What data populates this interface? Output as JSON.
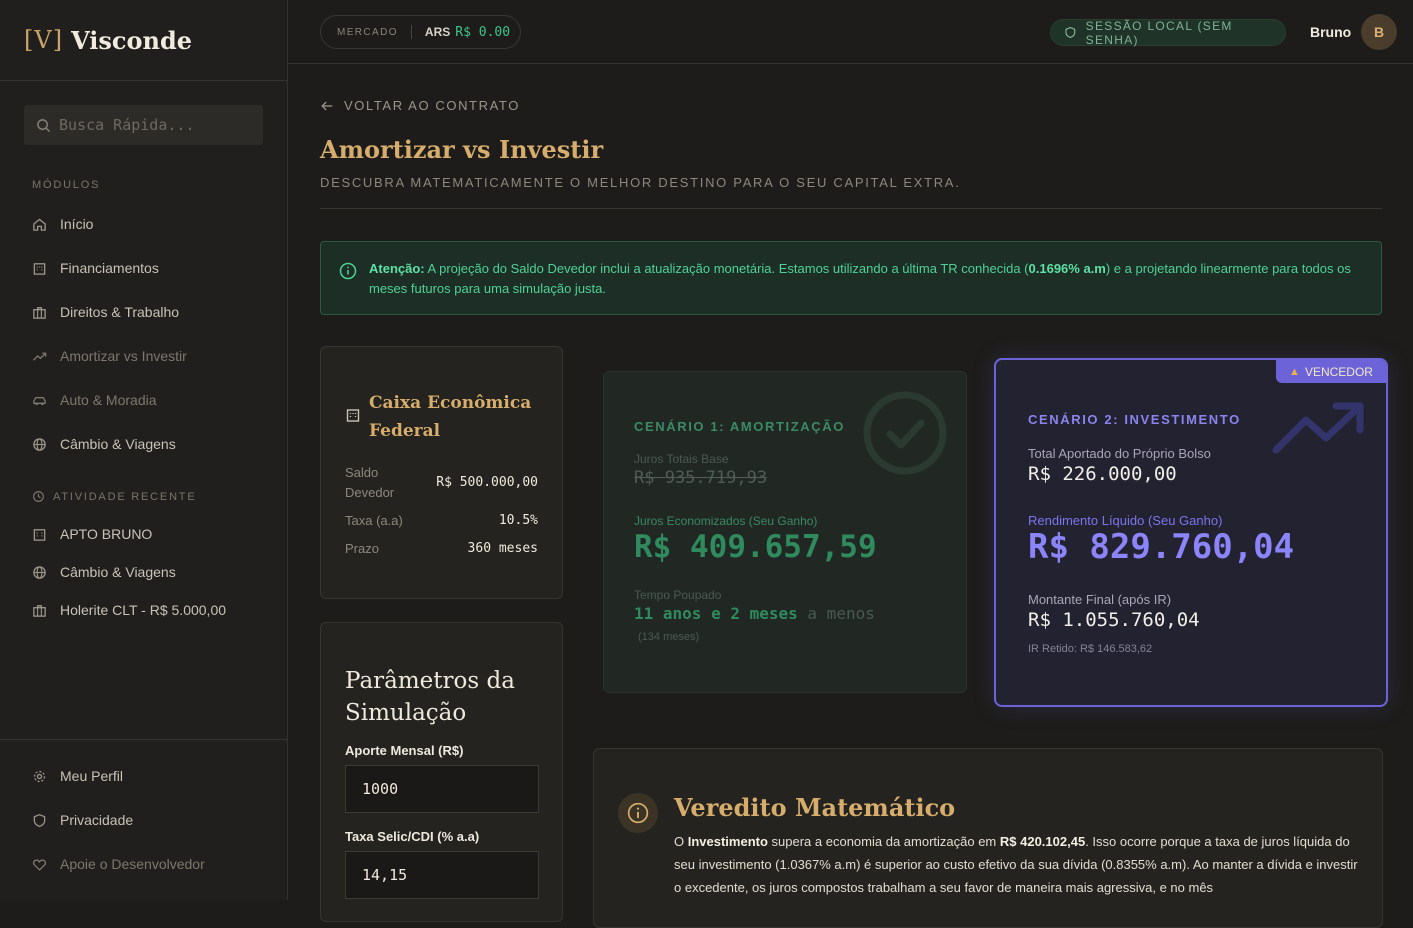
{
  "brand": {
    "bracket": "[V]",
    "name": "Visconde"
  },
  "search": {
    "placeholder": "Busca Rápida..."
  },
  "sidebar": {
    "modules_label": "MÓDULOS",
    "modules": [
      {
        "label": "Início",
        "icon": "home-icon"
      },
      {
        "label": "Financiamentos",
        "icon": "building-icon"
      },
      {
        "label": "Direitos & Trabalho",
        "icon": "briefcase-icon"
      },
      {
        "label": "Amortizar vs Investir",
        "icon": "trend-icon"
      },
      {
        "label": "Auto & Moradia",
        "icon": "car-icon"
      },
      {
        "label": "Câmbio & Viagens",
        "icon": "globe-icon"
      }
    ],
    "recent_label": "ATIVIDADE RECENTE",
    "recent": [
      {
        "label": "APTO BRUNO",
        "icon": "building-icon"
      },
      {
        "label": "Câmbio & Viagens",
        "icon": "globe-icon"
      },
      {
        "label": "Holerite CLT - R$ 5.000,00",
        "icon": "briefcase-icon"
      }
    ],
    "bottom": [
      {
        "label": "Meu Perfil",
        "icon": "gear-icon"
      },
      {
        "label": "Privacidade",
        "icon": "shield-icon"
      },
      {
        "label": "Apoie o Desenvolvedor",
        "icon": "heart-icon"
      }
    ]
  },
  "topbar": {
    "market_label": "MERCADO",
    "currency": "ARS",
    "rate": "R$ 0.00",
    "session": "SESSÃO LOCAL (SEM SENHA)",
    "user": "Bruno",
    "avatar_initial": "B"
  },
  "page": {
    "back": "VOLTAR AO CONTRATO",
    "title": "Amortizar vs Investir",
    "subtitle": "DESCUBRA MATEMATICAMENTE O MELHOR DESTINO PARA O SEU CAPITAL EXTRA."
  },
  "alert": {
    "bold": "Atenção:",
    "text1": " A projeção do Saldo Devedor inclui a atualização monetária. Estamos utilizando a última TR conhecida (",
    "rate": "0.1696% a.m",
    "text2": ") e a projetando linearmente para todos os meses futuros para uma simulação justa."
  },
  "contract": {
    "bank": "Caixa Econômica Federal",
    "saldo_label": "Saldo Devedor",
    "saldo_value": "R$ 500.000,00",
    "taxa_label": "Taxa (a.a)",
    "taxa_value": "10.5%",
    "prazo_label": "Prazo",
    "prazo_value": "360 meses"
  },
  "params": {
    "title": "Parâmetros da Simulação",
    "aporte_label": "Aporte Mensal (R$)",
    "aporte_value": "1000",
    "selic_label": "Taxa Selic/CDI (% a.a)",
    "selic_value": "14,15"
  },
  "scenario1": {
    "title": "CENÁRIO 1: AMORTIZAÇÃO",
    "base_label": "Juros Totais Base",
    "base_value": "R$ 935.719,93",
    "saved_label": "Juros Economizados (Seu Ganho)",
    "saved_value": "R$ 409.657,59",
    "time_label": "Tempo Poupado",
    "time_years": "11 anos",
    "time_and": " e ",
    "time_months": "2 meses",
    "time_less": " a menos",
    "months_total": "(134 meses)"
  },
  "scenario2": {
    "badge": "VENCEDOR",
    "title": "CENÁRIO 2: INVESTIMENTO",
    "contrib_label": "Total Aportado do Próprio Bolso",
    "contrib_value": "R$ 226.000,00",
    "yield_label": "Rendimento Líquido (Seu Ganho)",
    "yield_value": "R$ 829.760,04",
    "final_label": "Montante Final (após IR)",
    "final_value": "R$ 1.055.760,04",
    "ir": "IR Retido: R$ 146.583,62"
  },
  "verdict": {
    "title": "Veredito Matemático",
    "t1": "O ",
    "b1": "Investimento",
    "t2": " supera a economia da amortização em ",
    "b2": "R$ 420.102,45",
    "t3": ". Isso ocorre porque a taxa de juros líquida do seu investimento (1.0367% a.m) é superior ao custo efetivo da sua dívida (0.8355% a.m). Ao manter a dívida e investir o excedente, os juros compostos trabalham a seu favor de maneira mais agressiva, e no mês"
  },
  "colors": {
    "gold": "#d6ad6c",
    "green": "#3ec48a",
    "purple": "#6c63d9"
  }
}
